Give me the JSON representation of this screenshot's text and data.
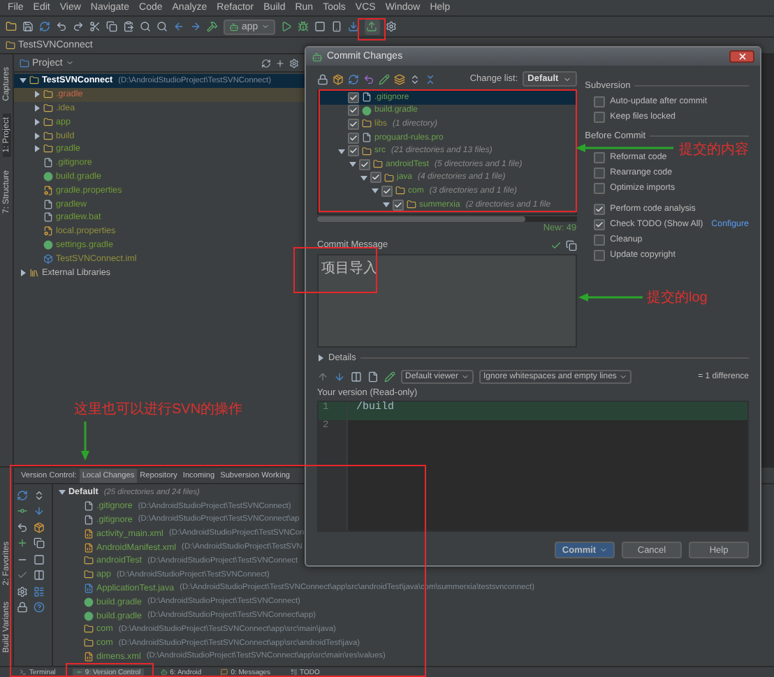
{
  "menu": [
    "File",
    "Edit",
    "View",
    "Navigate",
    "Code",
    "Analyze",
    "Refactor",
    "Build",
    "Run",
    "Tools",
    "VCS",
    "Window",
    "Help"
  ],
  "toolbar": {
    "run_config": "app"
  },
  "breadcrumb": "TestSVNConnect",
  "side_tabs_top": [
    {
      "label": "Captures",
      "selected": false
    },
    {
      "label": "1: Project",
      "selected": true
    },
    {
      "label": "7: Structure",
      "selected": false
    }
  ],
  "side_tabs_bottom": [
    {
      "label": "2: Favorites",
      "selected": false
    },
    {
      "label": "Build Variants",
      "selected": false
    }
  ],
  "project": {
    "selector": "Project",
    "tree": [
      {
        "name": "TestSVNConnect",
        "path": "(D:\\AndroidStudioProject\\TestSVNConnect)",
        "kind": "folder",
        "color": "#ffffff",
        "selected": true,
        "highlighted": false,
        "expanded": true,
        "children": [
          {
            "name": ".gradle",
            "kind": "folder",
            "color": "#c8684a",
            "selected": false,
            "highlighted": true,
            "expanded": false
          },
          {
            "name": ".idea",
            "kind": "folder",
            "color": "#8f8f3c",
            "selected": false,
            "highlighted": false,
            "expanded": false
          },
          {
            "name": "app",
            "kind": "folder",
            "color": "#6f9a35",
            "selected": false,
            "highlighted": false,
            "expanded": false
          },
          {
            "name": "build",
            "kind": "folder",
            "color": "#8f8f3c",
            "selected": false,
            "highlighted": false,
            "expanded": false
          },
          {
            "name": "gradle",
            "kind": "folder",
            "color": "#6f9a35",
            "selected": false,
            "highlighted": false,
            "expanded": false
          },
          {
            "name": ".gitignore",
            "kind": "file",
            "color": "#6f9a35",
            "selected": false,
            "highlighted": false
          },
          {
            "name": "build.gradle",
            "kind": "gradle",
            "color": "#6f9a35",
            "selected": false,
            "highlighted": false
          },
          {
            "name": "gradle.properties",
            "kind": "props",
            "color": "#6f9a35",
            "selected": false,
            "highlighted": false
          },
          {
            "name": "gradlew",
            "kind": "file",
            "color": "#6f9a35",
            "selected": false,
            "highlighted": false
          },
          {
            "name": "gradlew.bat",
            "kind": "file",
            "color": "#6f9a35",
            "selected": false,
            "highlighted": false
          },
          {
            "name": "local.properties",
            "kind": "props",
            "color": "#8f8f3c",
            "selected": false,
            "highlighted": false
          },
          {
            "name": "settings.gradle",
            "kind": "gradle",
            "color": "#6f9a35",
            "selected": false,
            "highlighted": false
          },
          {
            "name": "TestSVNConnect.iml",
            "kind": "module",
            "color": "#8f8f3c",
            "selected": false,
            "highlighted": false
          }
        ]
      },
      {
        "name": "External Libraries",
        "kind": "library",
        "color": "#bbbbbb",
        "selected": false,
        "highlighted": false,
        "expanded": false
      }
    ]
  },
  "dialog": {
    "title": "Commit Changes",
    "changelist_label": "Change list:",
    "changelist": "Default",
    "files": [
      {
        "name": ".gitignore",
        "kind": "file",
        "color": "#6a9f4e",
        "checked": true,
        "selected": true
      },
      {
        "name": "build.gradle",
        "kind": "gradle",
        "color": "#6a9f4e",
        "checked": true,
        "selected": false
      },
      {
        "name": "libs",
        "note": "(1 directory)",
        "kind": "folder",
        "color": "#8f8f3c",
        "checked": true,
        "selected": false
      },
      {
        "name": "proguard-rules.pro",
        "kind": "file",
        "color": "#6a9f4e",
        "checked": true,
        "selected": false
      },
      {
        "name": "src",
        "note": "(21 directories and 13 files)",
        "kind": "folder",
        "color": "#6a9f4e",
        "checked": true,
        "selected": false,
        "expanded": true,
        "children": [
          {
            "name": "androidTest",
            "note": "(5 directories and 1 file)",
            "kind": "folder",
            "color": "#6a9f4e",
            "checked": true,
            "selected": false,
            "expanded": true,
            "children": [
              {
                "name": "java",
                "note": "(4 directories and 1 file)",
                "kind": "folder",
                "color": "#6a9f4e",
                "checked": true,
                "selected": false,
                "expanded": true,
                "children": [
                  {
                    "name": "com",
                    "note": "(3 directories and 1 file)",
                    "kind": "folder",
                    "color": "#6a9f4e",
                    "checked": true,
                    "selected": false,
                    "expanded": true,
                    "children": [
                      {
                        "name": "summerxia",
                        "note": "(2 directories and 1 file",
                        "kind": "folder",
                        "color": "#6a9f4e",
                        "checked": true,
                        "selected": false,
                        "expanded": true
                      }
                    ]
                  }
                ]
              }
            ]
          }
        ]
      }
    ],
    "new_count": "New: 49",
    "message_label": "Commit Message",
    "message": "项目导入",
    "subversion": {
      "title": "Subversion",
      "options": [
        {
          "label": "Auto-update after commit",
          "checked": false
        },
        {
          "label": "Keep files locked",
          "checked": false
        }
      ]
    },
    "before_commit": {
      "title": "Before Commit",
      "options": [
        {
          "label": "Reformat code",
          "checked": false
        },
        {
          "label": "Rearrange code",
          "checked": false
        },
        {
          "label": "Optimize imports",
          "checked": false
        },
        {
          "label": "Perform code analysis",
          "checked": true
        },
        {
          "label": "Check TODO (Show All)",
          "checked": true,
          "link": "Configure"
        },
        {
          "label": "Cleanup",
          "checked": false
        },
        {
          "label": "Update copyright",
          "checked": false
        }
      ]
    },
    "details_label": "Details",
    "diff": {
      "viewer": "Default viewer",
      "whitespace": "Ignore whitespaces and empty lines",
      "summary": "= 1 difference",
      "version_label": "Your version (Read-only)",
      "lines": [
        {
          "number": "1",
          "text": "/build",
          "changed": true
        },
        {
          "number": "2",
          "changed": false
        }
      ]
    },
    "buttons": [
      {
        "label": "Commit",
        "default": true
      },
      {
        "label": "Cancel",
        "default": false
      },
      {
        "label": "Help",
        "default": false
      }
    ]
  },
  "vc_panel": {
    "title": "Version Control:",
    "tabs": [
      {
        "label": "Local Changes",
        "selected": true
      },
      {
        "label": "Repository",
        "selected": false
      },
      {
        "label": "Incoming",
        "selected": false
      },
      {
        "label": "Subversion Working",
        "selected": false
      }
    ],
    "changelist": {
      "name": "Default",
      "summary": "(25 directories and 24 files)",
      "expanded": true
    },
    "files": [
      {
        "name": ".gitignore",
        "path": "(D:\\AndroidStudioProject\\TestSVNConnect)",
        "kind": "file",
        "color": "#6a9f4e"
      },
      {
        "name": ".gitignore",
        "path": "(D:\\AndroidStudioProject\\TestSVNConnect\\ap",
        "kind": "file",
        "color": "#6a9f4e"
      },
      {
        "name": "activity_main.xml",
        "path": "(D:\\AndroidStudioProject\\TestSVNCon",
        "kind": "xml",
        "color": "#6a9f4e"
      },
      {
        "name": "AndroidManifest.xml",
        "path": "(D:\\AndroidStudioProject\\TestSVN",
        "kind": "xml",
        "color": "#6a9f4e"
      },
      {
        "name": "androidTest",
        "path": "(D:\\AndroidStudioProject\\TestSVNConnect",
        "kind": "folder",
        "color": "#6a9f4e"
      },
      {
        "name": "app",
        "path": "(D:\\AndroidStudioProject\\TestSVNConnect)",
        "kind": "folder",
        "color": "#6a9f4e"
      },
      {
        "name": "ApplicationTest.java",
        "path": "(D:\\AndroidStudioProject\\TestSVNConnect\\app\\src\\androidTest\\java\\com\\summerxia\\testsvnconnect)",
        "kind": "java",
        "color": "#6a9f4e"
      },
      {
        "name": "build.gradle",
        "path": "(D:\\AndroidStudioProject\\TestSVNConnect)",
        "kind": "gradle",
        "color": "#6a9f4e"
      },
      {
        "name": "build.gradle",
        "path": "(D:\\AndroidStudioProject\\TestSVNConnect\\app)",
        "kind": "gradle",
        "color": "#6a9f4e"
      },
      {
        "name": "com",
        "path": "(D:\\AndroidStudioProject\\TestSVNConnect\\app\\src\\main\\java)",
        "kind": "folder",
        "color": "#6a9f4e"
      },
      {
        "name": "com",
        "path": "(D:\\AndroidStudioProject\\TestSVNConnect\\app\\src\\androidTest\\java)",
        "kind": "folder",
        "color": "#6a9f4e"
      },
      {
        "name": "dimens.xml",
        "path": "(D:\\AndroidStudioProject\\TestSVNConnect\\app\\src\\main\\res\\values)",
        "kind": "xml",
        "color": "#6a9f4e"
      }
    ]
  },
  "tool_windows": [
    {
      "label": "Terminal",
      "selected": false
    },
    {
      "label": "9: Version Control",
      "selected": true
    },
    {
      "label": "6: Android",
      "selected": false
    },
    {
      "label": "0: Messages",
      "selected": false
    },
    {
      "label": "TODO",
      "selected": false
    }
  ],
  "annotations": [
    "提交的内容",
    "提交的log",
    "这里也可以进行SVN的操作"
  ]
}
